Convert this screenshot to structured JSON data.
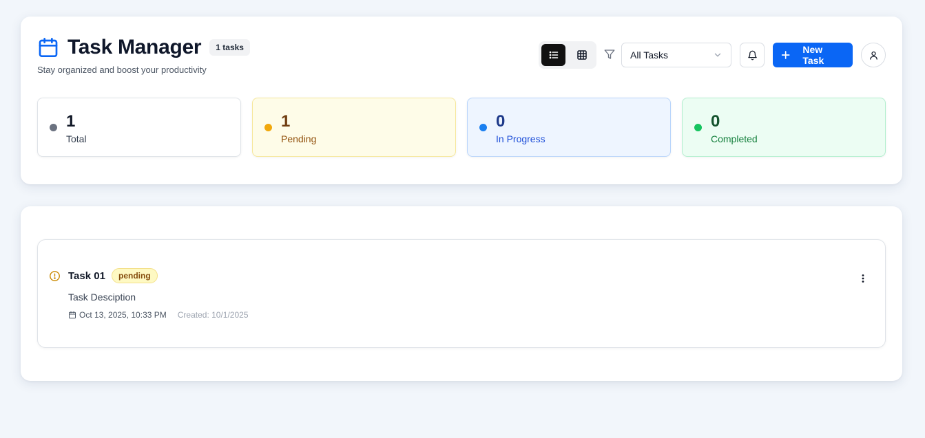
{
  "header": {
    "title": "Task Manager",
    "task_count_badge": "1 tasks",
    "subtitle": "Stay organized and boost your productivity",
    "view_modes": [
      "list",
      "grid"
    ],
    "active_view": "list",
    "filter_select": {
      "selected": "All Tasks"
    },
    "new_task_label": "New Task"
  },
  "stats": [
    {
      "value": "1",
      "label": "Total",
      "color": "#6b7280"
    },
    {
      "value": "1",
      "label": "Pending",
      "color": "#f1a80c"
    },
    {
      "value": "0",
      "label": "In Progress",
      "color": "#1a7ff0"
    },
    {
      "value": "0",
      "label": "Completed",
      "color": "#16c45f"
    }
  ],
  "tasks": [
    {
      "title": "Task 01",
      "status": "pending",
      "description": "Task Desciption",
      "due": "Oct 13, 2025, 10:33 PM",
      "created": "Created: 10/1/2025"
    }
  ],
  "colors": {
    "accent": "#0a66f5",
    "background": "#f2f6fb"
  }
}
